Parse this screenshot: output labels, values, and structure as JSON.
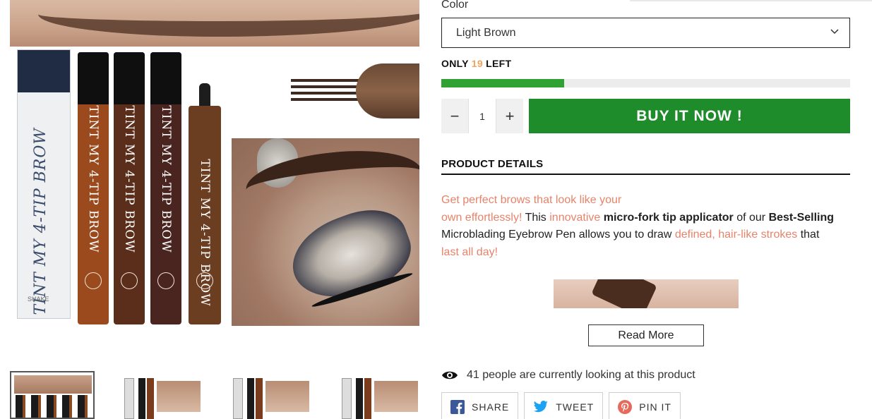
{
  "gallery": {
    "box_text": "TINT MY 4-TIP BROW",
    "box_brand": "SUAKE",
    "pen_label": "TINT MY 4-TIP BROW",
    "thumbnails": [
      "thumb-1",
      "thumb-2",
      "thumb-3",
      "thumb-4"
    ],
    "active_thumbnail_index": 0
  },
  "product_form": {
    "color_label": "Color",
    "color_selected": "Light Brown",
    "stock": {
      "prefix": "ONLY",
      "count": "19",
      "suffix": "LEFT",
      "fill_fraction": 0.3,
      "bar_color": "#2fa233"
    },
    "quantity": {
      "minus": "−",
      "value": "1",
      "plus": "+"
    },
    "buy_now_label": "BUY IT NOW !",
    "buy_now_color": "#1f8c2b",
    "details_title": "PRODUCT DETAILS",
    "description": {
      "p1": "Get perfect brows that look like your",
      "p2_hl": "own effortlessly!",
      "p3": " This ",
      "p4_hl": "innovative",
      "p5_b": " micro-fork tip applicator",
      "p6": " of our ",
      "p7_b": "Best-Selling",
      "p8": " Microblading Eyebrow Pen allows you to draw ",
      "p9_hl": "defined, hair-like strokes",
      "p10": " that ",
      "p11_hl": "last all day!"
    },
    "highlight_color": "#e8836a",
    "read_more_label": "Read More",
    "viewers_text": "41 people are currently looking at this product",
    "share_buttons": [
      {
        "icon": "facebook-icon",
        "label": "SHARE"
      },
      {
        "icon": "twitter-icon",
        "label": "TWEET"
      },
      {
        "icon": "pinterest-icon",
        "label": "PIN IT"
      }
    ]
  }
}
